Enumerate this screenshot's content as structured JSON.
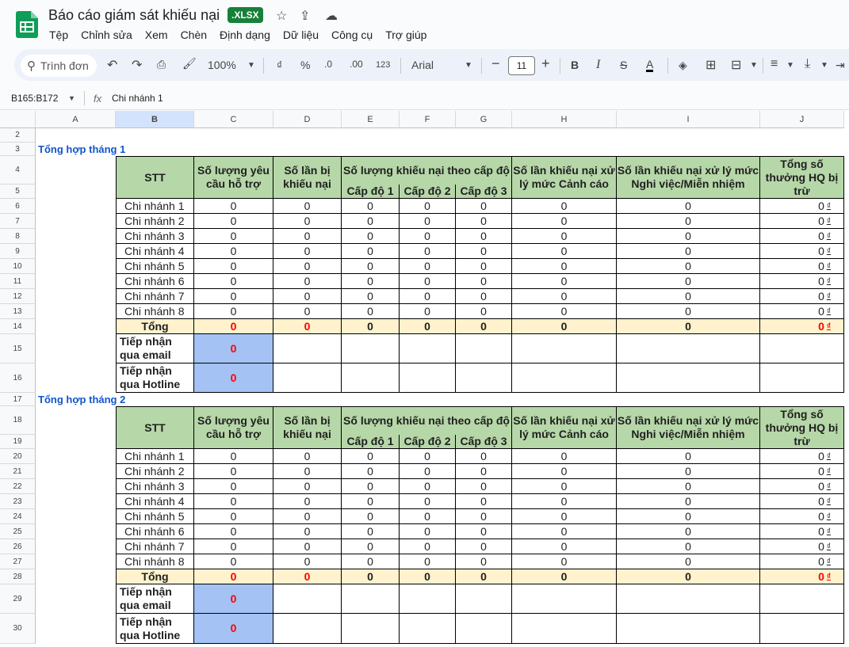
{
  "doc": {
    "title": "Báo cáo giám sát khiếu nại",
    "badge": ".XLSX"
  },
  "menu": [
    "Tệp",
    "Chỉnh sửa",
    "Xem",
    "Chèn",
    "Định dạng",
    "Dữ liệu",
    "Công cụ",
    "Trợ giúp"
  ],
  "toolbar": {
    "search": "Trình đơn",
    "zoom": "100%",
    "currency": "₫",
    "percent": "%",
    "dec_minus": ".0",
    "dec_plus": ".00",
    "num_format": "123",
    "font": "Arial",
    "font_size": "11"
  },
  "formula": {
    "namebox": "B165:B172",
    "fx": "fx",
    "value": "Chi nhánh 1"
  },
  "columns": [
    "A",
    "B",
    "C",
    "D",
    "E",
    "F",
    "G",
    "H",
    "I",
    "J"
  ],
  "rows": [
    "2",
    "3",
    "4",
    "5",
    "6",
    "7",
    "8",
    "9",
    "10",
    "11",
    "12",
    "13",
    "14",
    "15",
    "16",
    "17",
    "18",
    "19",
    "20",
    "21",
    "22",
    "23",
    "24",
    "25",
    "26",
    "27",
    "28",
    "29",
    "30"
  ],
  "headers": {
    "stt": "STT",
    "requests": "Số lượng yêu cầu hỗ trợ",
    "complaints": "Số lần bị khiếu nại",
    "by_level": "Số lượng khiếu nại theo cấp độ",
    "level1": "Cấp độ 1",
    "level2": "Cấp độ 2",
    "level3": "Cấp độ 3",
    "warning": "Số lần khiếu nại xử lý mức Cảnh cáo",
    "dismiss": "Số lần khiếu nại xử lý mức Nghi việc/Miễn nhiệm",
    "bonus": "Tổng số thưởng HQ bị trừ"
  },
  "currency_symbol": "₫",
  "sections": [
    {
      "title": "Tổng hợp tháng 1",
      "branches": [
        {
          "name": "Chi nhánh 1",
          "c": "0",
          "d": "0",
          "e": "0",
          "f": "0",
          "g": "0",
          "h": "0",
          "i": "0",
          "j": "0"
        },
        {
          "name": "Chi nhánh 2",
          "c": "0",
          "d": "0",
          "e": "0",
          "f": "0",
          "g": "0",
          "h": "0",
          "i": "0",
          "j": "0"
        },
        {
          "name": "Chi nhánh 3",
          "c": "0",
          "d": "0",
          "e": "0",
          "f": "0",
          "g": "0",
          "h": "0",
          "i": "0",
          "j": "0"
        },
        {
          "name": "Chi nhánh 4",
          "c": "0",
          "d": "0",
          "e": "0",
          "f": "0",
          "g": "0",
          "h": "0",
          "i": "0",
          "j": "0"
        },
        {
          "name": "Chi nhánh 5",
          "c": "0",
          "d": "0",
          "e": "0",
          "f": "0",
          "g": "0",
          "h": "0",
          "i": "0",
          "j": "0"
        },
        {
          "name": "Chi nhánh 6",
          "c": "0",
          "d": "0",
          "e": "0",
          "f": "0",
          "g": "0",
          "h": "0",
          "i": "0",
          "j": "0"
        },
        {
          "name": "Chi nhánh 7",
          "c": "0",
          "d": "0",
          "e": "0",
          "f": "0",
          "g": "0",
          "h": "0",
          "i": "0",
          "j": "0"
        },
        {
          "name": "Chi nhánh 8",
          "c": "0",
          "d": "0",
          "e": "0",
          "f": "0",
          "g": "0",
          "h": "0",
          "i": "0",
          "j": "0"
        }
      ],
      "total": {
        "label": "Tổng",
        "c": "0",
        "d": "0",
        "e": "0",
        "f": "0",
        "g": "0",
        "h": "0",
        "i": "0",
        "j": "0"
      },
      "email": {
        "label": "Tiếp nhận qua email",
        "value": "0"
      },
      "hotline": {
        "label": "Tiếp nhận qua Hotline",
        "value": "0"
      }
    },
    {
      "title": "Tổng hợp tháng 2",
      "branches": [
        {
          "name": "Chi nhánh 1",
          "c": "0",
          "d": "0",
          "e": "0",
          "f": "0",
          "g": "0",
          "h": "0",
          "i": "0",
          "j": "0"
        },
        {
          "name": "Chi nhánh 2",
          "c": "0",
          "d": "0",
          "e": "0",
          "f": "0",
          "g": "0",
          "h": "0",
          "i": "0",
          "j": "0"
        },
        {
          "name": "Chi nhánh 3",
          "c": "0",
          "d": "0",
          "e": "0",
          "f": "0",
          "g": "0",
          "h": "0",
          "i": "0",
          "j": "0"
        },
        {
          "name": "Chi nhánh 4",
          "c": "0",
          "d": "0",
          "e": "0",
          "f": "0",
          "g": "0",
          "h": "0",
          "i": "0",
          "j": "0"
        },
        {
          "name": "Chi nhánh 5",
          "c": "0",
          "d": "0",
          "e": "0",
          "f": "0",
          "g": "0",
          "h": "0",
          "i": "0",
          "j": "0"
        },
        {
          "name": "Chi nhánh 6",
          "c": "0",
          "d": "0",
          "e": "0",
          "f": "0",
          "g": "0",
          "h": "0",
          "i": "0",
          "j": "0"
        },
        {
          "name": "Chi nhánh 7",
          "c": "0",
          "d": "0",
          "e": "0",
          "f": "0",
          "g": "0",
          "h": "0",
          "i": "0",
          "j": "0"
        },
        {
          "name": "Chi nhánh 8",
          "c": "0",
          "d": "0",
          "e": "0",
          "f": "0",
          "g": "0",
          "h": "0",
          "i": "0",
          "j": "0"
        }
      ],
      "total": {
        "label": "Tổng",
        "c": "0",
        "d": "0",
        "e": "0",
        "f": "0",
        "g": "0",
        "h": "0",
        "i": "0",
        "j": "0"
      },
      "email": {
        "label": "Tiếp nhận qua email",
        "value": "0"
      },
      "hotline": {
        "label": "Tiếp nhận qua Hotline",
        "value": "0"
      }
    }
  ]
}
